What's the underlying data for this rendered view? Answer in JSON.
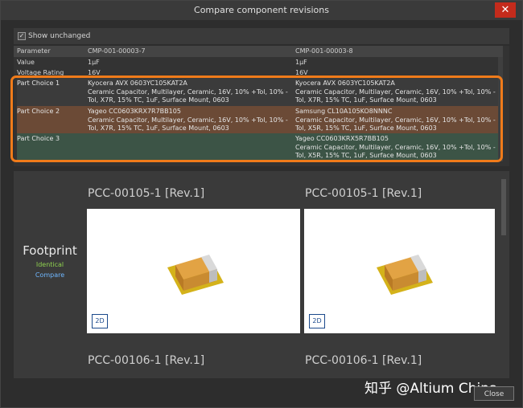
{
  "window": {
    "title": "Compare component revisions",
    "close_glyph": "✕"
  },
  "options": {
    "show_unchanged_label": "Show unchanged",
    "show_unchanged_checked": true
  },
  "grid": {
    "headers": [
      "Parameter",
      "CMP-001-00003-7",
      "CMP-001-00003-8"
    ],
    "rows": [
      [
        "Value",
        "1µF",
        "1µF"
      ],
      [
        "Voltage Rating",
        "16V",
        "16V"
      ]
    ],
    "part_choices": [
      {
        "label": "Part Choice 1",
        "left": [
          "Kyocera AVX 0603YC105KAT2A",
          "Ceramic Capacitor, Multilayer, Ceramic, 16V, 10% +Tol, 10% -Tol, X7R, 15% TC, 1uF, Surface Mount, 0603"
        ],
        "right": [
          "Kyocera AVX 0603YC105KAT2A",
          "Ceramic Capacitor, Multilayer, Ceramic, 16V, 10% +Tol, 10% -Tol, X7R, 15% TC, 1uF, Surface Mount, 0603"
        ],
        "bg": "#3b3b3b"
      },
      {
        "label": "Part Choice 2",
        "left": [
          "Yageo CC0603KRX7R7BB105",
          "Ceramic Capacitor, Multilayer, Ceramic, 16V, 10% +Tol, 10% -Tol, X7R, 15% TC, 1uF, Surface Mount, 0603"
        ],
        "right": [
          "Samsung CL10A105KO8NNNC",
          "Ceramic Capacitor, Multilayer, Ceramic, 16V, 10% +Tol, 10% -Tol, X5R, 15% TC, 1uF, Surface Mount, 0603"
        ],
        "bg": "#6b4a36"
      },
      {
        "label": "Part Choice 3",
        "left": [
          "",
          ""
        ],
        "right": [
          "Yageo CC0603KRX5R7BB105",
          "Ceramic Capacitor, Multilayer, Ceramic, 16V, 10% +Tol, 10% -Tol, X5R, 15% TC, 1uF, Surface Mount, 0603"
        ],
        "bg": "#3c5446"
      }
    ],
    "highlight_color": "#f07b1a"
  },
  "preview": {
    "section_label": "Footprint",
    "status": "Identical",
    "compare_link": "Compare",
    "left_title": "PCC-00105-1 [Rev.1]",
    "right_title": "PCC-00105-1 [Rev.1]",
    "left_title_2": "PCC-00106-1 [Rev.1]",
    "right_title_2": "PCC-00106-1 [Rev.1]",
    "view_button": "2D"
  },
  "footer": {
    "close_label": "Close",
    "watermark": "知乎 @Altium China"
  }
}
